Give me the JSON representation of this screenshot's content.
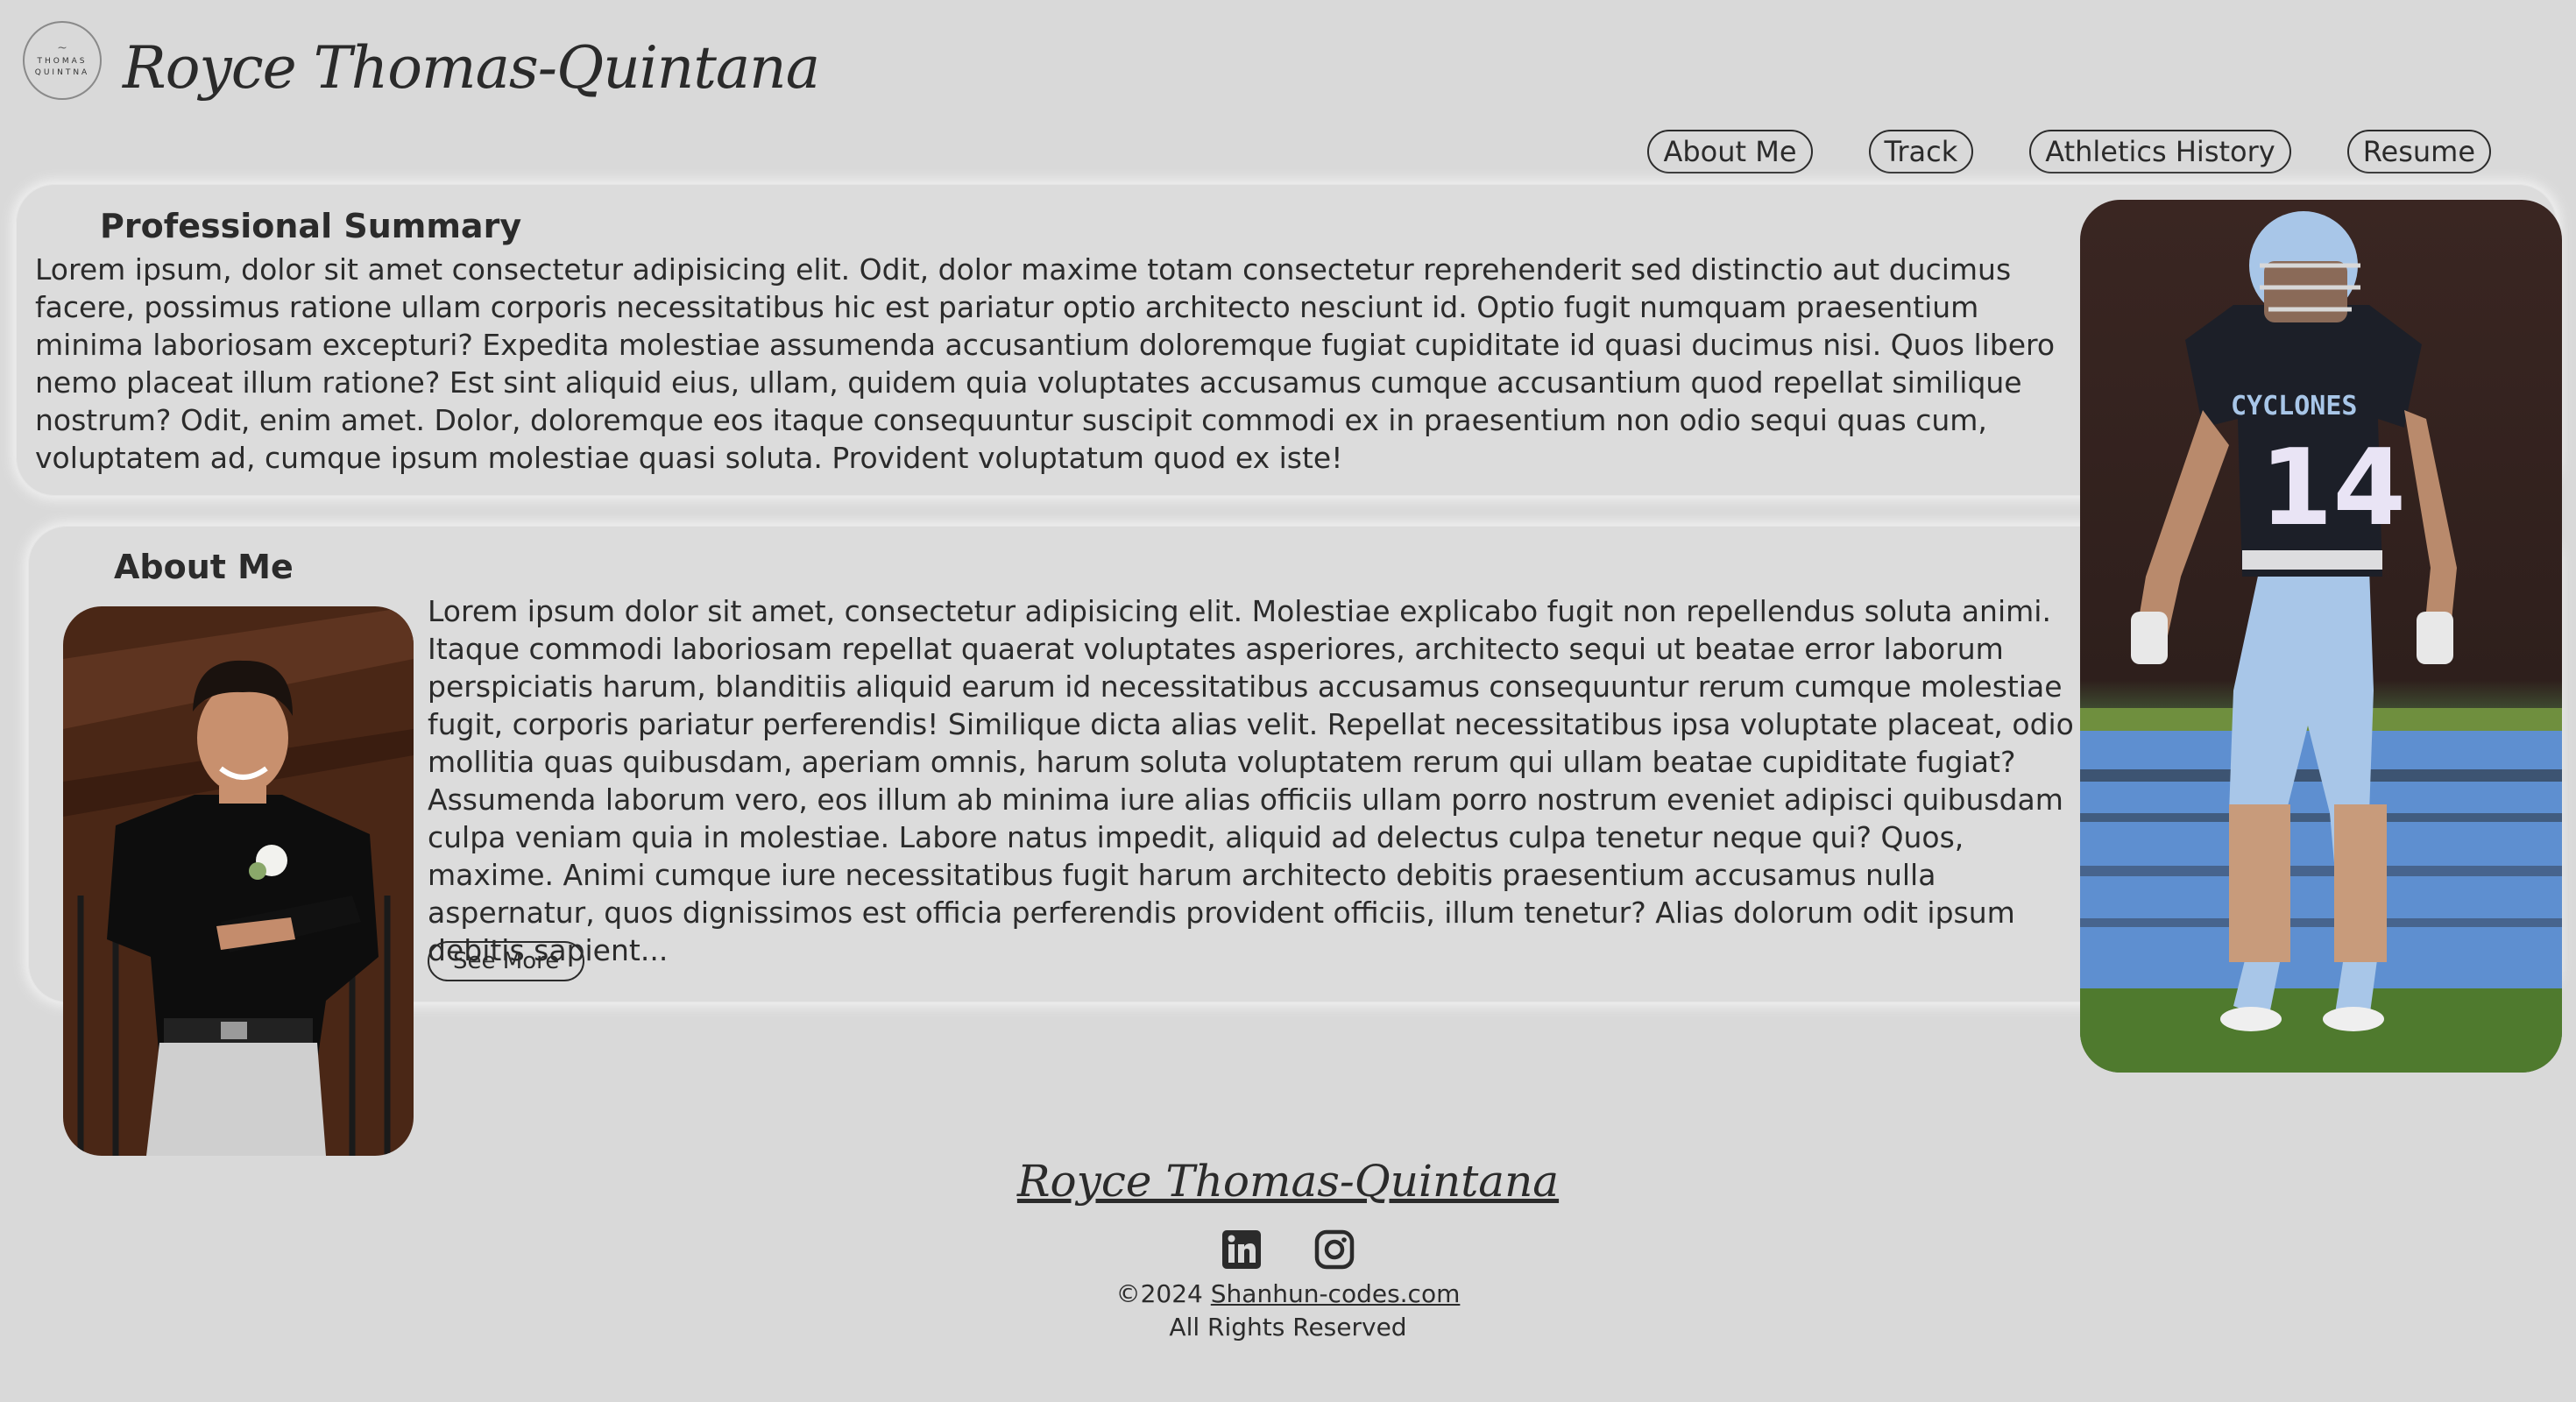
{
  "header": {
    "logo_text_line1": "THOMAS",
    "logo_text_line2": "QUINTNA",
    "title": "Royce Thomas-Quintana"
  },
  "nav": {
    "items": [
      {
        "label": "About Me"
      },
      {
        "label": "Track"
      },
      {
        "label": "Athletics History"
      },
      {
        "label": "Resume"
      }
    ]
  },
  "summary": {
    "title": "Professional Summary",
    "text": "Lorem ipsum, dolor sit amet consectetur adipisicing elit. Odit, dolor maxime totam consectetur reprehenderit sed distinctio aut ducimus facere, possimus ratione ullam corporis necessitatibus hic est pariatur optio architecto nesciunt id. Optio fugit numquam praesentium minima laboriosam excepturi? Expedita molestiae assumenda accusantium doloremque fugiat cupiditate id quasi ducimus nisi. Quos libero nemo placeat illum ratione? Est sint aliquid eius, ullam, quidem quia voluptates accusamus cumque accusantium quod repellat similique nostrum? Odit, enim amet. Dolor, doloremque eos itaque consequuntur suscipit commodi ex in praesentium non odio sequi quas cum, voluptatem ad, cumque ipsum molestiae quasi soluta. Provident voluptatum quod ex iste!"
  },
  "about": {
    "title": "About Me",
    "text": "Lorem ipsum dolor sit amet, consectetur adipisicing elit. Molestiae explicabo fugit non repellendus soluta animi. Itaque commodi laboriosam repellat quaerat voluptates asperiores, architecto sequi ut beatae error laborum perspiciatis harum, blanditiis aliquid earum id necessitatibus accusamus consequuntur rerum cumque molestiae fugit, corporis pariatur perferendis! Similique dicta alias velit. Repellat necessitatibus ipsa voluptate placeat, odio mollitia quas quibusdam, aperiam omnis, harum soluta voluptatem rerum qui ullam beatae cupiditate fugiat? Assumenda laborum vero, eos illum ab minima iure alias officiis ullam porro nostrum eveniet adipisci quibusdam culpa veniam quia in molestiae. Labore natus impedit, aliquid ad delectus culpa tenetur neque qui? Quos, maxime. Animi cumque iure necessitatibus fugit harum architecto debitis praesentium accusamus nulla aspernatur, quos dignissimos est officia perferendis provident officiis, illum tenetur? Alias dolorum odit ipsum debitis sapient...",
    "see_more_label": "See More"
  },
  "athlete_photo": {
    "jersey_text": "CYCLONES",
    "jersey_number": "14"
  },
  "footer": {
    "name": "Royce Thomas-Quintana",
    "social_icons": [
      "linkedin-icon",
      "instagram-icon"
    ],
    "copyright_prefix": "©2024 ",
    "copyright_link": "Shanhun-codes.com",
    "rights": "All Rights Reserved"
  },
  "colors": {
    "background": "#d9d9d9",
    "text": "#2b2b2b",
    "card": "#dcdcdc",
    "field_blue": "#5e8fd0",
    "jersey_blue": "#a8c6e8"
  }
}
